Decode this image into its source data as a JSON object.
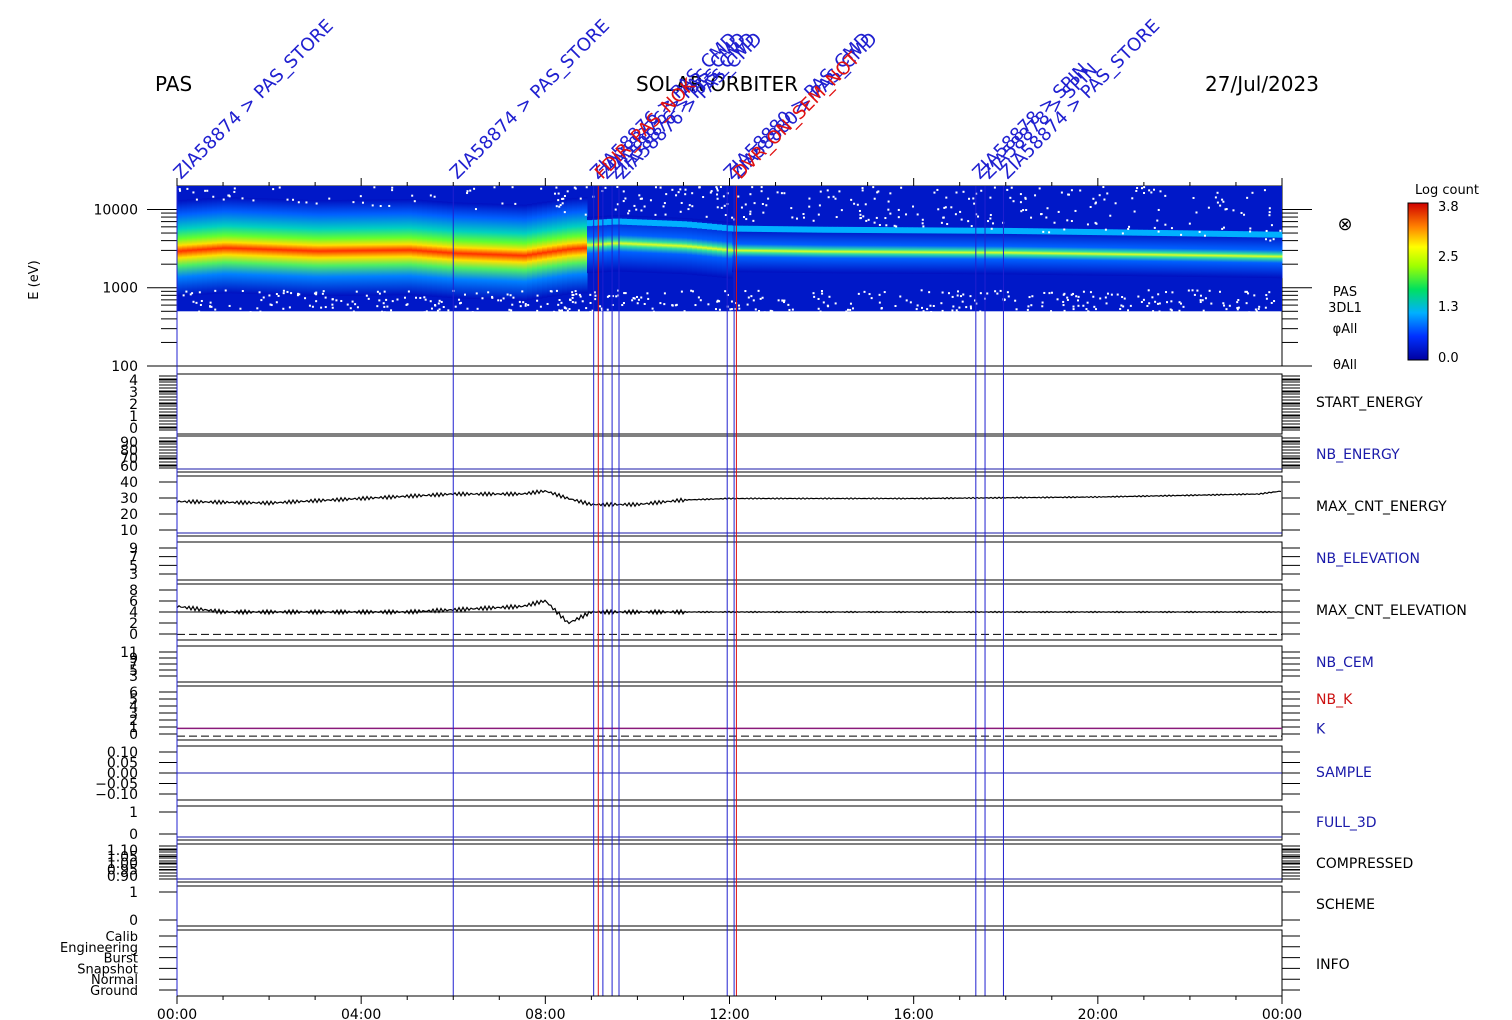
{
  "header": {
    "left": "PAS",
    "center": "SOLAR ORBITER",
    "right": "27/Jul/2023"
  },
  "annotations": {
    "blue": [
      {
        "hour": 0.0,
        "label": "ZIA58874 > PAS_STORE"
      },
      {
        "hour": 6.0,
        "label": "ZIA58874 > PAS_STORE"
      },
      {
        "hour": 9.05,
        "label": "ZIA58876 > PAS_CMD"
      },
      {
        "hour": 9.25,
        "label": "ZIA58876 > PAS_CMD"
      },
      {
        "hour": 9.45,
        "label": "ZIA58876 > PAS_CMD"
      },
      {
        "hour": 9.6,
        "label": "ZIA58876 > PAS_CMD"
      },
      {
        "hour": 11.95,
        "label": "ZIA58880 > PAS_CMD"
      },
      {
        "hour": 12.1,
        "label": "ZIA58880 > PAS_CMD"
      },
      {
        "hour": 17.35,
        "label": "ZIA58878 > SPIN"
      },
      {
        "hour": 17.55,
        "label": "ZIA58878 > SPIN"
      },
      {
        "hour": 17.95,
        "label": "ZIA58874 > PAS_STORE"
      }
    ],
    "red": [
      {
        "hour": 9.15,
        "label": "FDIR_PAS_NOK"
      },
      {
        "hour": 12.15,
        "label": "DVR_ON_SEM_NOT"
      }
    ]
  },
  "chart_data": {
    "type": "spectrogram-timeseries",
    "x_axis": {
      "ticks": [
        "00:00",
        "04:00",
        "08:00",
        "12:00",
        "16:00",
        "20:00",
        "00:00"
      ],
      "range_hours": [
        0,
        24
      ]
    },
    "spectrogram": {
      "ylabel": "E (eV)",
      "yticks": [
        "10000",
        "1000",
        "100"
      ],
      "ylog_range": [
        100,
        10000
      ],
      "instrument_labels": [
        "PAS",
        "3DL1",
        "φAll",
        "θAll"
      ],
      "colorbar": {
        "title": "Log count",
        "ticks": [
          "3.8",
          "2.5",
          "1.3",
          "0.0"
        ],
        "range": [
          0.0,
          3.8
        ]
      },
      "peak_energy_eV": [
        {
          "hour": 0.0,
          "e": 3200
        },
        {
          "hour": 1.0,
          "e": 3500
        },
        {
          "hour": 3.0,
          "e": 3200
        },
        {
          "hour": 5.0,
          "e": 3300
        },
        {
          "hour": 6.0,
          "e": 3000
        },
        {
          "hour": 7.5,
          "e": 2800
        },
        {
          "hour": 8.5,
          "e": 3400
        },
        {
          "hour": 9.5,
          "e": 3700
        },
        {
          "hour": 11.0,
          "e": 3400
        },
        {
          "hour": 12.0,
          "e": 3000
        },
        {
          "hour": 14.0,
          "e": 2900
        },
        {
          "hour": 18.0,
          "e": 2800
        },
        {
          "hour": 24.0,
          "e": 2500
        }
      ]
    },
    "panels": [
      {
        "label": "START_ENERGY",
        "label_color": "#000000",
        "yticks": [
          "4",
          "3",
          "2",
          "1",
          "0"
        ],
        "ylim": [
          0,
          4
        ]
      },
      {
        "label": "NB_ENERGY",
        "label_color": "#1a1aaa",
        "yticks": [
          "90",
          "80",
          "70",
          "60"
        ],
        "ylim": [
          60,
          90
        ]
      },
      {
        "label": "MAX_CNT_ENERGY",
        "label_color": "#000000",
        "yticks": [
          "40",
          "30",
          "20",
          "10"
        ],
        "ylim": [
          5,
          45
        ],
        "series": [
          {
            "hour": 0.0,
            "v": 28
          },
          {
            "hour": 2.0,
            "v": 27
          },
          {
            "hour": 4.0,
            "v": 30
          },
          {
            "hour": 6.0,
            "v": 33
          },
          {
            "hour": 7.5,
            "v": 33
          },
          {
            "hour": 8.0,
            "v": 35
          },
          {
            "hour": 8.5,
            "v": 30
          },
          {
            "hour": 9.0,
            "v": 26
          },
          {
            "hour": 10.0,
            "v": 26
          },
          {
            "hour": 11.0,
            "v": 29
          },
          {
            "hour": 12.0,
            "v": 30
          },
          {
            "hour": 16.0,
            "v": 30
          },
          {
            "hour": 20.0,
            "v": 31
          },
          {
            "hour": 23.5,
            "v": 33
          },
          {
            "hour": 24.0,
            "v": 35
          }
        ]
      },
      {
        "label": "NB_ELEVATION",
        "label_color": "#1a1aaa",
        "yticks": [
          "9",
          "7",
          "5",
          "3"
        ],
        "ylim": [
          2,
          10
        ]
      },
      {
        "label": "MAX_CNT_ELEVATION",
        "label_color": "#000000",
        "yticks": [
          "8",
          "6",
          "4",
          "2",
          "0"
        ],
        "ylim": [
          -1,
          9
        ],
        "series": [
          {
            "hour": 0.0,
            "v": 5
          },
          {
            "hour": 1.0,
            "v": 4
          },
          {
            "hour": 3.0,
            "v": 4
          },
          {
            "hour": 5.0,
            "v": 4
          },
          {
            "hour": 7.5,
            "v": 5
          },
          {
            "hour": 8.0,
            "v": 6
          },
          {
            "hour": 8.5,
            "v": 2
          },
          {
            "hour": 9.0,
            "v": 4
          },
          {
            "hour": 11.0,
            "v": 4
          },
          {
            "hour": 24.0,
            "v": 4
          }
        ]
      },
      {
        "label": "NB_CEM",
        "label_color": "#1a1aaa",
        "yticks": [
          "11",
          "9",
          "7",
          "5",
          "3"
        ],
        "ylim": [
          2,
          12
        ]
      },
      {
        "label": "NB_K",
        "label_color": "#cc1111",
        "yticks": [
          "6",
          "5",
          "4",
          "3",
          "2",
          "1",
          "0"
        ],
        "ylim": [
          -0.5,
          6.5
        ]
      },
      {
        "label": "SAMPLE",
        "label_color": "#1a1aaa",
        "yticks": [
          "0.10",
          "0.05",
          "0.00",
          "−0.05",
          "−0.10"
        ],
        "ylim": [
          -0.12,
          0.12
        ]
      },
      {
        "label": "FULL_3D",
        "label_color": "#1a1aaa",
        "yticks": [
          "1",
          "0"
        ],
        "ylim": [
          -0.5,
          1.5
        ]
      },
      {
        "label": "COMPRESSED",
        "label_color": "#000000",
        "yticks": [
          "1.10",
          "1.05",
          "1.00",
          "0.95",
          "0.90"
        ],
        "ylim": [
          0.88,
          1.12
        ]
      },
      {
        "label": "SCHEME",
        "label_color": "#000000",
        "yticks": [
          "1",
          "0"
        ],
        "ylim": [
          -0.5,
          1.5
        ]
      },
      {
        "label": "INFO",
        "label_color": "#000000",
        "yticks": [
          "Calib",
          "Engineering",
          "Burst",
          "Snapshot",
          "Normal",
          "Ground"
        ]
      }
    ],
    "k_label": "K"
  }
}
